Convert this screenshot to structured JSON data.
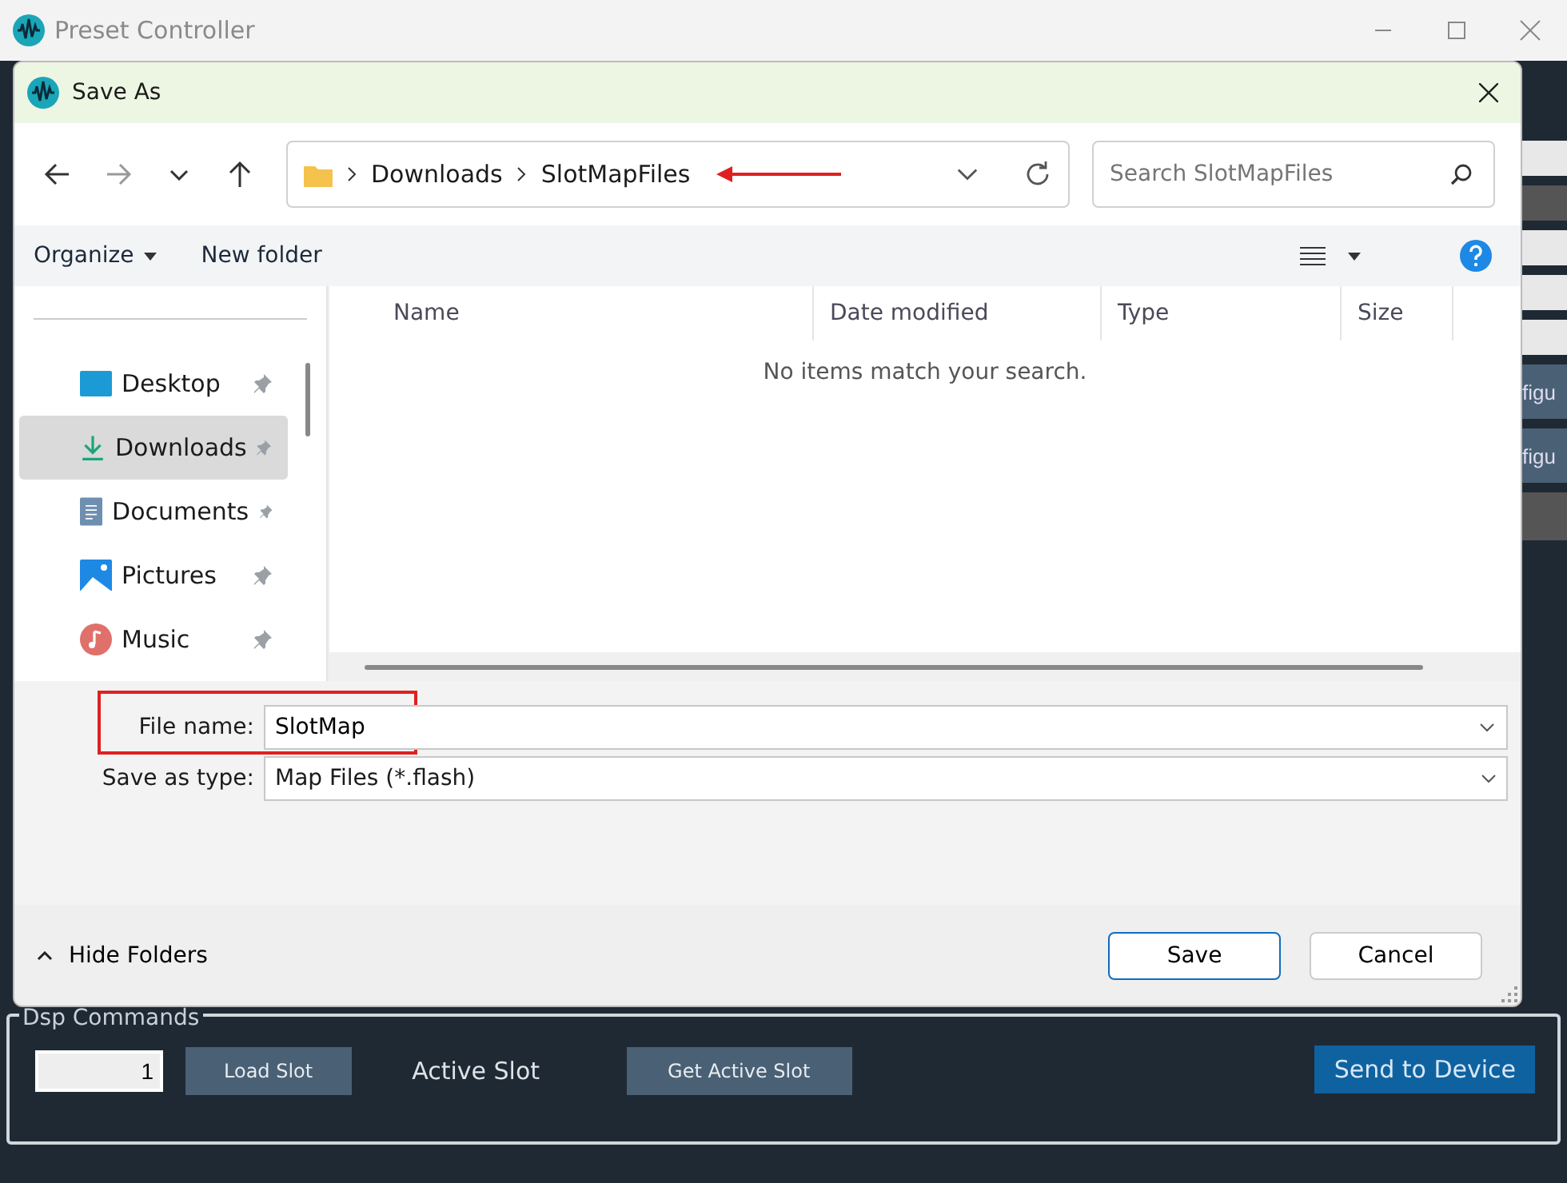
{
  "window": {
    "title": "Preset Controller"
  },
  "dialog": {
    "title": "Save As",
    "breadcrumb": [
      "Downloads",
      "SlotMapFiles"
    ],
    "search": {
      "placeholder": "Search SlotMapFiles"
    },
    "commands": [
      "Organize",
      "New folder"
    ],
    "nav_items": [
      {
        "label": "Desktop",
        "kind": "desktop",
        "selected": false
      },
      {
        "label": "Downloads",
        "kind": "downloads",
        "selected": true
      },
      {
        "label": "Documents",
        "kind": "documents",
        "selected": false
      },
      {
        "label": "Pictures",
        "kind": "pictures",
        "selected": false
      },
      {
        "label": "Music",
        "kind": "music",
        "selected": false
      }
    ],
    "columns": [
      "Name",
      "Date modified",
      "Type",
      "Size"
    ],
    "empty_message": "No items match your search.",
    "file_name": {
      "label": "File name:",
      "value": "SlotMap"
    },
    "save_as_type": {
      "label": "Save as type:",
      "value": "Map Files (*.flash)"
    },
    "hide_folders": "Hide Folders",
    "buttons": [
      "Save",
      "Cancel"
    ]
  },
  "background": {
    "side_buttons": [
      "figu",
      "figu"
    ]
  },
  "dsp_commands": {
    "title": "Dsp Commands",
    "slot_value": "1",
    "load_slot": "Load Slot",
    "active_slot": "Active Slot",
    "get_active_slot": "Get Active Slot",
    "send": "Send to Device"
  }
}
